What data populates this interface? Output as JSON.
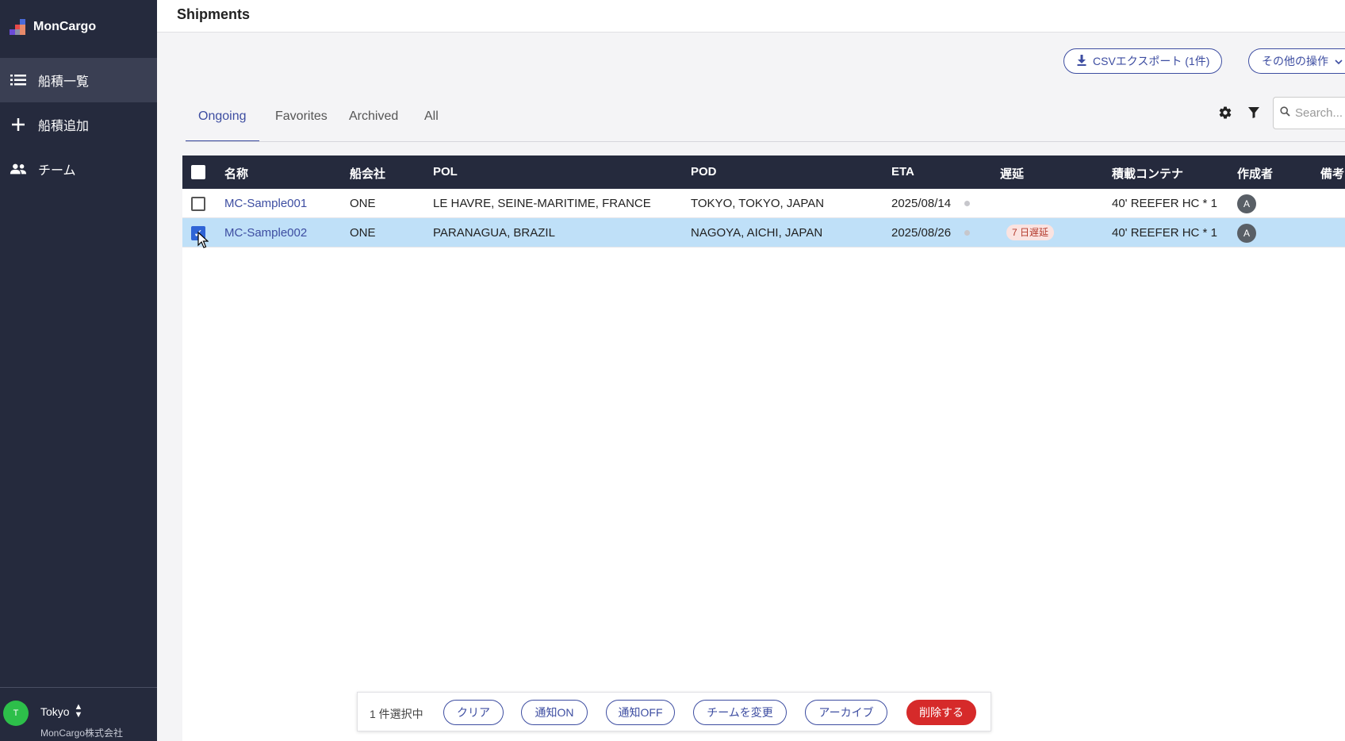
{
  "app": {
    "name": "MonCargo"
  },
  "sidebar": {
    "items": [
      {
        "label": "船積一覧",
        "icon": "list-icon",
        "active": true
      },
      {
        "label": "船積追加",
        "icon": "plus-icon",
        "active": false
      },
      {
        "label": "チーム",
        "icon": "team-icon",
        "active": false
      }
    ],
    "workspace": {
      "avatar": "T",
      "name": "Tokyo",
      "company": "MonCargo株式会社"
    }
  },
  "header": {
    "title": "Shipments"
  },
  "toolbar": {
    "csv_export_label": "CSVエクスポート (1件)",
    "other_actions_label": "その他の操作",
    "search_placeholder": "Search..."
  },
  "tabs": [
    {
      "label": "Ongoing",
      "active": true
    },
    {
      "label": "Favorites",
      "active": false
    },
    {
      "label": "Archived",
      "active": false
    },
    {
      "label": "All",
      "active": false
    }
  ],
  "table": {
    "columns": [
      "名称",
      "船会社",
      "POL",
      "POD",
      "ETA",
      "遅延",
      "積載コンテナ",
      "作成者",
      "備考"
    ],
    "rows": [
      {
        "name": "MC-Sample001",
        "carrier": "ONE",
        "pol": "LE HAVRE, SEINE-MARITIME, FRANCE",
        "pod": "TOKYO, TOKYO, JAPAN",
        "eta": "2025/08/14",
        "delay": "",
        "container": "40' REEFER HC * 1",
        "creator": "A",
        "selected": false
      },
      {
        "name": "MC-Sample002",
        "carrier": "ONE",
        "pol": "PARANAGUA, BRAZIL",
        "pod": "NAGOYA, AICHI, JAPAN",
        "eta": "2025/08/26",
        "delay": "7 日遅延",
        "container": "40' REEFER HC * 1",
        "creator": "A",
        "selected": true
      }
    ]
  },
  "bulk_bar": {
    "count_label": "1 件選択中",
    "clear": "クリア",
    "notify_on": "通知ON",
    "notify_off": "通知OFF",
    "change_team": "チームを変更",
    "archive": "アーカイブ",
    "delete": "削除する"
  },
  "colors": {
    "sidebar_bg": "#252a3d",
    "accent": "#3d4da1",
    "selected_row": "#bfe0f8",
    "danger": "#d62a2a"
  }
}
